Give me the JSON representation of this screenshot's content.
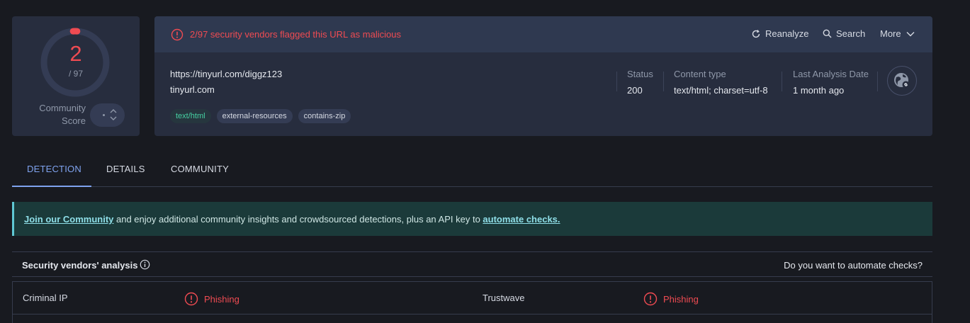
{
  "score": {
    "value": "2",
    "total": "/ 97",
    "flagged": 2,
    "vendors_total": 97,
    "community_label_line1": "Community",
    "community_label_line2": "Score",
    "ring_color": "#ef4b52"
  },
  "header": {
    "alert": "2/97 security vendors flagged this URL as malicious",
    "actions": {
      "reanalyze": "Reanalyze",
      "search": "Search",
      "more": "More"
    },
    "url": "https://tinyurl.com/diggz123",
    "domain": "tinyurl.com",
    "tags": [
      "text/html",
      "external-resources",
      "contains-zip"
    ],
    "meta": {
      "status_label": "Status",
      "status_value": "200",
      "content_type_label": "Content type",
      "content_type_value": "text/html; charset=utf-8",
      "last_analysis_label": "Last Analysis Date",
      "last_analysis_value": "1 month ago"
    }
  },
  "tabs": [
    "DETECTION",
    "DETAILS",
    "COMMUNITY"
  ],
  "banner": {
    "link1": "Join our Community",
    "middle": " and enjoy additional community insights and crowdsourced detections, plus an API key to ",
    "link2": "automate checks."
  },
  "vendors": {
    "title": "Security vendors' analysis",
    "automate": "Do you want to automate checks?",
    "rows": [
      {
        "left_name": "Criminal IP",
        "left_result": "Phishing",
        "right_name": "Trustwave",
        "right_result": "Phishing"
      }
    ]
  },
  "colors": {
    "malicious": "#ef4b52",
    "accent": "#7fa3ef",
    "tag_green": "#46d1a3"
  }
}
